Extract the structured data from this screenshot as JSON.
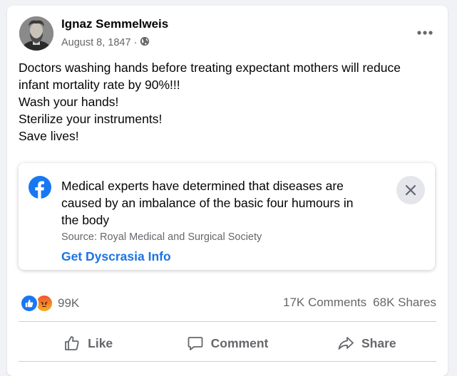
{
  "post": {
    "author": "Ignaz Semmelweis",
    "date": "August 8, 1847",
    "separator": "·",
    "privacy_icon": "globe-icon",
    "more_icon": "more-options-icon",
    "text_lines": [
      "Doctors washing hands before treating expectant mothers will reduce",
      "infant mortality rate by 90%!!!",
      "Wash your hands!",
      "Sterilize your instruments!",
      "Save lives!"
    ]
  },
  "notice": {
    "icon": "facebook-icon",
    "message_lines": [
      "Medical experts have determined that diseases are",
      "caused by an imbalance of the basic four humours in",
      "the body"
    ],
    "source": "Source: Royal Medical and Surgical Society",
    "link_label": "Get Dyscrasia Info",
    "close_icon": "close-icon"
  },
  "engagement": {
    "reaction_icons": [
      "like-reaction-icon",
      "angry-reaction-icon"
    ],
    "reaction_count": "99K",
    "comments": "17K Comments",
    "shares": "68K Shares"
  },
  "actions": {
    "like": "Like",
    "comment": "Comment",
    "share": "Share"
  },
  "colors": {
    "accent": "#1b74e4",
    "facebook_blue": "#1877f2",
    "secondary_text": "#65676b"
  }
}
